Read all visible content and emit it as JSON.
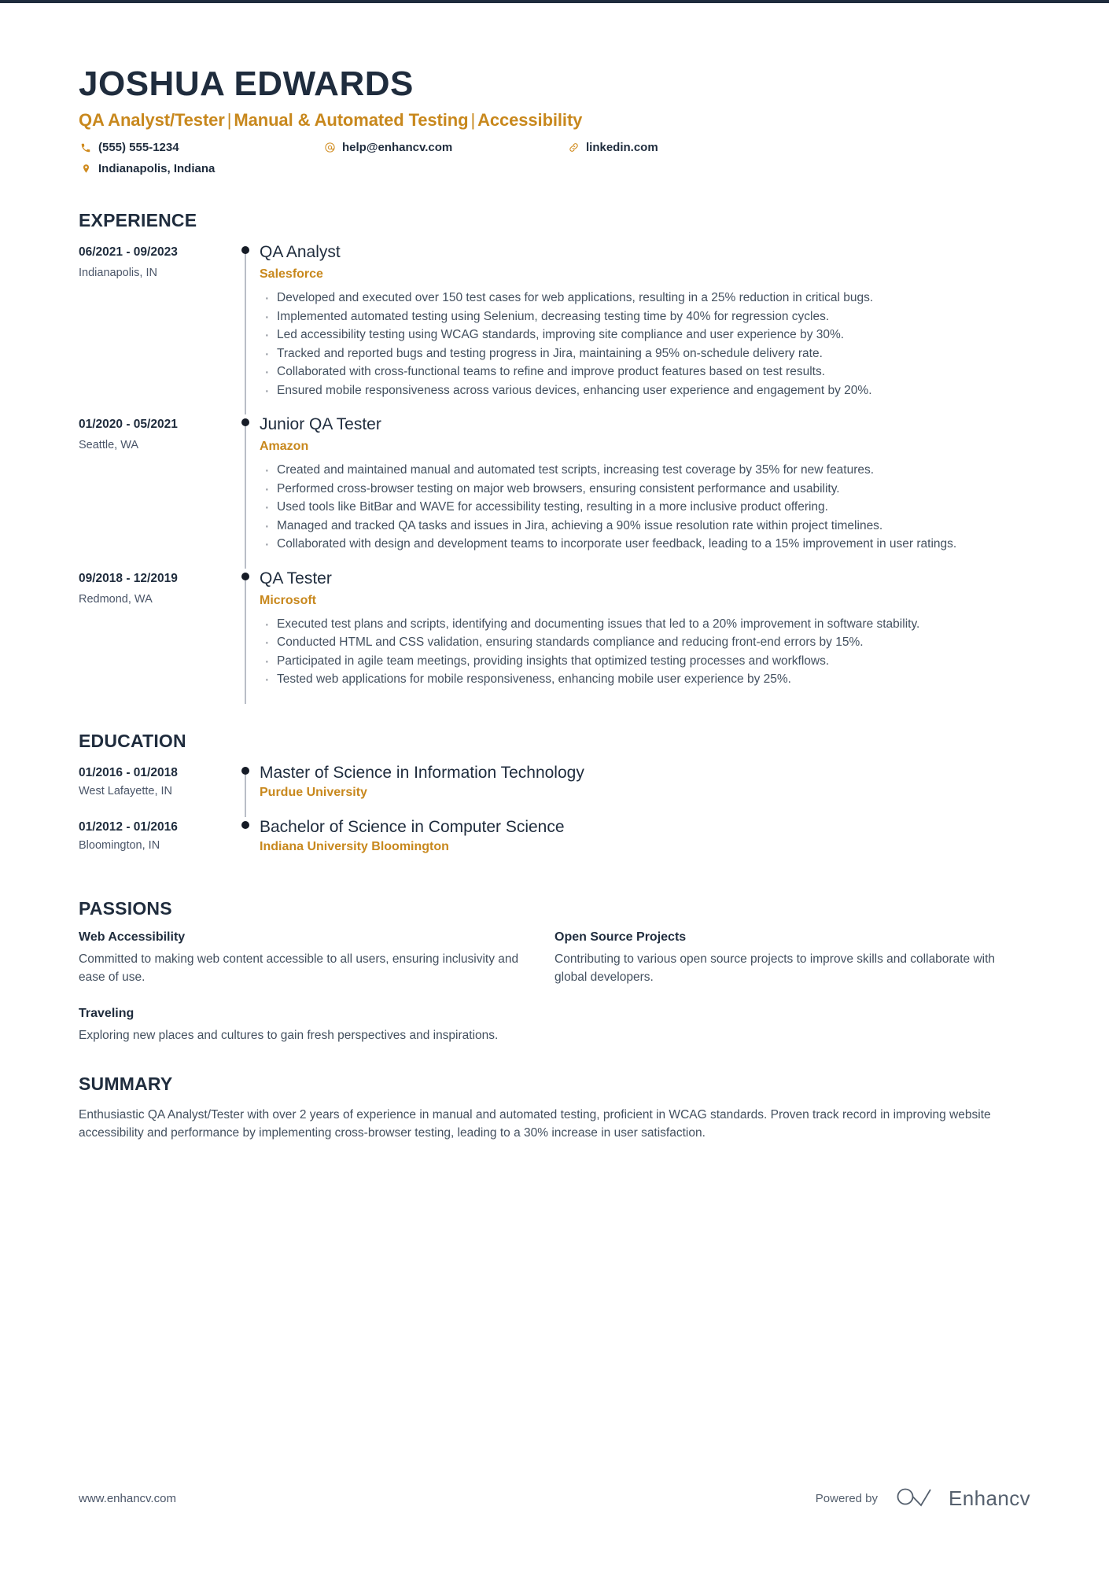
{
  "header": {
    "name": "JOSHUA EDWARDS",
    "headline_parts": [
      "QA Analyst/Tester",
      "Manual & Automated Testing",
      "Accessibility"
    ],
    "headline": "QA Analyst/Tester | Manual & Automated Testing | Accessibility",
    "contacts": [
      {
        "icon": "phone-icon",
        "glyph": "✆",
        "text": "(555) 555-1234"
      },
      {
        "icon": "email-icon",
        "glyph": "@",
        "text": "help@enhancv.com"
      },
      {
        "icon": "link-icon",
        "glyph": "ὑ7",
        "text": "linkedin.com"
      },
      {
        "icon": "location-icon",
        "glyph": "●",
        "text": "Indianapolis, Indiana"
      }
    ]
  },
  "colors": {
    "accent": "#c8881d",
    "dark": "#1f2c3d",
    "body": "#43505f",
    "rail": "#b9bec7"
  },
  "experience": {
    "title": "EXPERIENCE",
    "entries": [
      {
        "date": "06/2021 - 09/2023",
        "location": "Indianapolis, IN",
        "role": "QA Analyst",
        "company": "Salesforce",
        "bullets": [
          "Developed and executed over 150 test cases for web applications, resulting in a 25% reduction in critical bugs.",
          "Implemented automated testing using Selenium, decreasing testing time by 40% for regression cycles.",
          "Led accessibility testing using WCAG standards, improving site compliance and user experience by 30%.",
          "Tracked and reported bugs and testing progress in Jira, maintaining a 95% on-schedule delivery rate.",
          "Collaborated with cross-functional teams to refine and improve product features based on test results.",
          "Ensured mobile responsiveness across various devices, enhancing user experience and engagement by 20%."
        ]
      },
      {
        "date": "01/2020 - 05/2021",
        "location": "Seattle, WA",
        "role": "Junior QA Tester",
        "company": "Amazon",
        "bullets": [
          "Created and maintained manual and automated test scripts, increasing test coverage by 35% for new features.",
          "Performed cross-browser testing on major web browsers, ensuring consistent performance and usability.",
          "Used tools like BitBar and WAVE for accessibility testing, resulting in a more inclusive product offering.",
          "Managed and tracked QA tasks and issues in Jira, achieving a 90% issue resolution rate within project timelines.",
          "Collaborated with design and development teams to incorporate user feedback, leading to a 15% improvement in user ratings."
        ]
      },
      {
        "date": "09/2018 - 12/2019",
        "location": "Redmond, WA",
        "role": "QA Tester",
        "company": "Microsoft",
        "bullets": [
          "Executed test plans and scripts, identifying and documenting issues that led to a 20% improvement in software stability.",
          "Conducted HTML and CSS validation, ensuring standards compliance and reducing front-end errors by 15%.",
          "Participated in agile team meetings, providing insights that optimized testing processes and workflows.",
          "Tested web applications for mobile responsiveness, enhancing mobile user experience by 25%."
        ]
      }
    ]
  },
  "education": {
    "title": "EDUCATION",
    "entries": [
      {
        "date": "01/2016 - 01/2018",
        "location": "West Lafayette, IN",
        "degree": "Master of Science in Information Technology",
        "school": "Purdue University"
      },
      {
        "date": "01/2012 - 01/2016",
        "location": "Bloomington, IN",
        "degree": "Bachelor of Science in Computer Science",
        "school": "Indiana University Bloomington"
      }
    ]
  },
  "passions": {
    "title": "PASSIONS",
    "items": [
      {
        "name": "Web Accessibility",
        "description": "Committed to making web content accessible to all users, ensuring inclusivity and ease of use."
      },
      {
        "name": "Open Source Projects",
        "description": "Contributing to various open source projects to improve skills and collaborate with global developers."
      },
      {
        "name": "Traveling",
        "description": "Exploring new places and cultures to gain fresh perspectives and inspirations."
      }
    ]
  },
  "summary": {
    "title": "SUMMARY",
    "text": "Enthusiastic QA Analyst/Tester with over 2 years of experience in manual and automated testing, proficient in WCAG standards. Proven track record in improving website accessibility and performance by implementing cross-browser testing, leading to a 30% increase in user satisfaction."
  },
  "footer": {
    "url": "www.enhancv.com",
    "powered_by": "Powered by",
    "brand": "Enhancv"
  }
}
